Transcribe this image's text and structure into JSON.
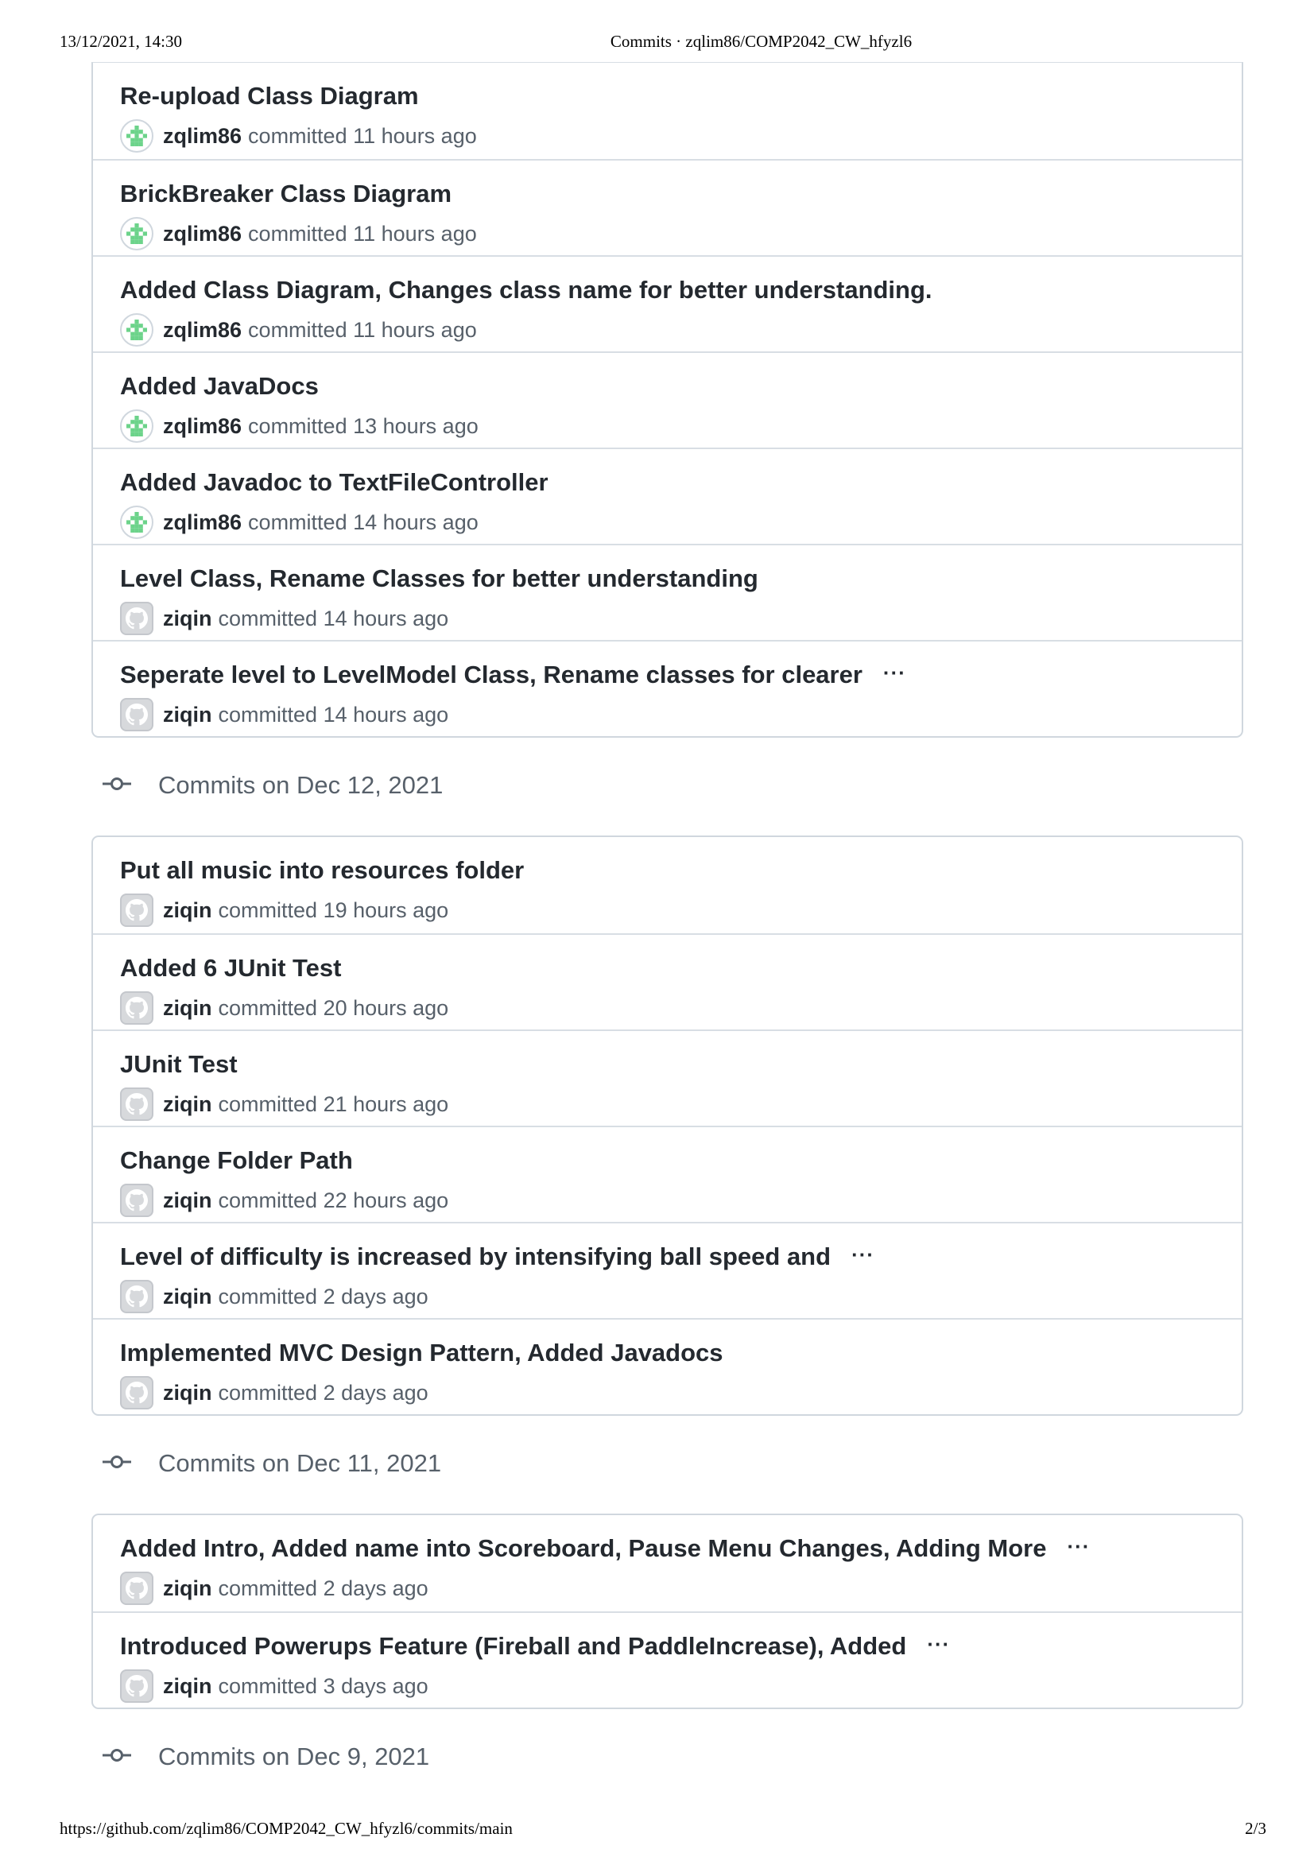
{
  "print_header": {
    "datetime": "13/12/2021, 14:30",
    "title": "Commits · zqlim86/COMP2042_CW_hfyzl6"
  },
  "print_footer": {
    "url": "https://github.com/zqlim86/COMP2042_CW_hfyzl6/commits/main",
    "page": "2/3"
  },
  "committed_word": "committed",
  "ellipsis": "···",
  "continued_group": {
    "commits": [
      {
        "title": "Re-upload Class Diagram",
        "author": "zqlim86",
        "time": "11 hours ago",
        "avatar": "identicon",
        "truncated": false
      },
      {
        "title": "BrickBreaker Class Diagram",
        "author": "zqlim86",
        "time": "11 hours ago",
        "avatar": "identicon",
        "truncated": false
      },
      {
        "title": "Added Class Diagram, Changes class name for better understanding.",
        "author": "zqlim86",
        "time": "11 hours ago",
        "avatar": "identicon",
        "truncated": false
      },
      {
        "title": "Added JavaDocs",
        "author": "zqlim86",
        "time": "13 hours ago",
        "avatar": "identicon",
        "truncated": false
      },
      {
        "title": "Added Javadoc to TextFileController",
        "author": "zqlim86",
        "time": "14 hours ago",
        "avatar": "identicon",
        "truncated": false
      },
      {
        "title": "Level Class, Rename Classes for better understanding",
        "author": "ziqin",
        "time": "14 hours ago",
        "avatar": "github",
        "truncated": false
      },
      {
        "title": "Seperate level to LevelModel Class, Rename classes for clearer",
        "author": "ziqin",
        "time": "14 hours ago",
        "avatar": "github",
        "truncated": true
      }
    ]
  },
  "groups": [
    {
      "label": "Commits on Dec 12, 2021",
      "commits": [
        {
          "title": "Put all music into resources folder",
          "author": "ziqin",
          "time": "19 hours ago",
          "avatar": "github",
          "truncated": false
        },
        {
          "title": "Added 6 JUnit Test",
          "author": "ziqin",
          "time": "20 hours ago",
          "avatar": "github",
          "truncated": false
        },
        {
          "title": "JUnit Test",
          "author": "ziqin",
          "time": "21 hours ago",
          "avatar": "github",
          "truncated": false
        },
        {
          "title": "Change Folder Path",
          "author": "ziqin",
          "time": "22 hours ago",
          "avatar": "github",
          "truncated": false
        },
        {
          "title": "Level of difficulty is increased by intensifying ball speed and",
          "author": "ziqin",
          "time": "2 days ago",
          "avatar": "github",
          "truncated": true
        },
        {
          "title": "Implemented MVC Design Pattern, Added Javadocs",
          "author": "ziqin",
          "time": "2 days ago",
          "avatar": "github",
          "truncated": false
        }
      ]
    },
    {
      "label": "Commits on Dec 11, 2021",
      "commits": [
        {
          "title": "Added Intro, Added name into Scoreboard, Pause Menu Changes, Adding More",
          "author": "ziqin",
          "time": "2 days ago",
          "avatar": "github",
          "truncated": true
        },
        {
          "title": "Introduced Powerups Feature (Fireball and PaddleIncrease), Added",
          "author": "ziqin",
          "time": "3 days ago",
          "avatar": "github",
          "truncated": true
        }
      ]
    },
    {
      "label": "Commits on Dec 9, 2021",
      "commits": []
    }
  ],
  "colors": {
    "border": "#d0d7de",
    "text_primary": "#24292f",
    "text_muted": "#57606a",
    "identicon_green": "#6cd38a"
  }
}
